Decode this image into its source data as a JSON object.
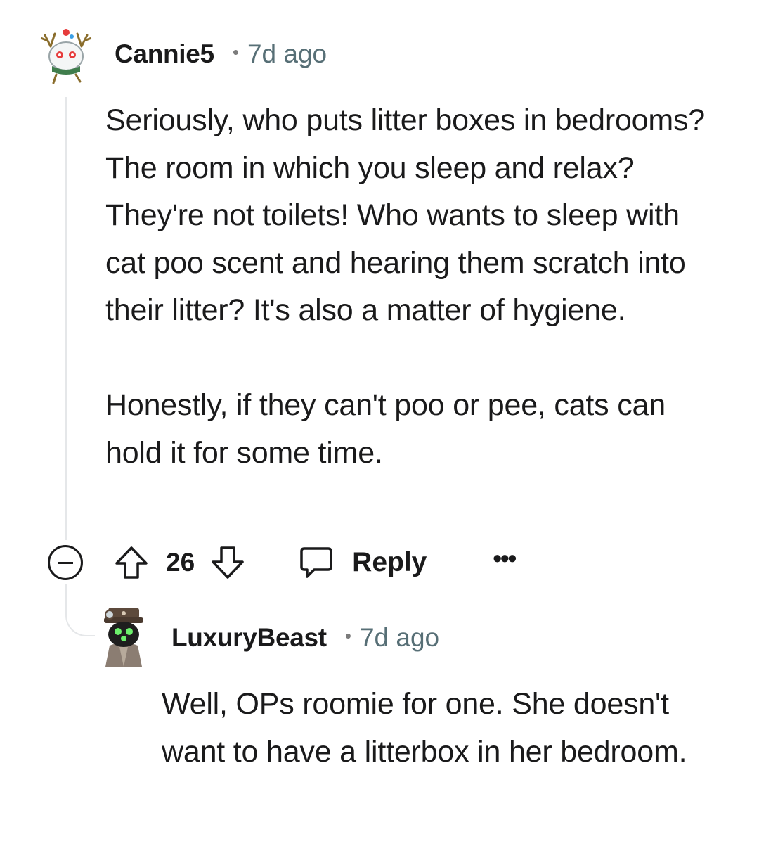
{
  "comments": [
    {
      "username": "Cannie5",
      "separator": "•",
      "time": "7d ago",
      "avatar_icon": "snow-cat-avatar",
      "paragraphs": [
        "Seriously, who puts litter boxes in bedrooms? The room in which you sleep and relax? They're not toilets! Who wants to sleep with cat poo scent and hearing them scratch into their litter? It's also a matter of hygiene.",
        "Honestly, if they can't poo or pee, cats can hold it for some time."
      ],
      "actions": {
        "collapse_icon": "minus-circle-icon",
        "upvote_icon": "arrow-up-icon",
        "vote_count": "26",
        "downvote_icon": "arrow-down-icon",
        "reply_icon": "comment-bubble-icon",
        "reply_label": "Reply",
        "more_label": "•••"
      }
    },
    {
      "username": "LuxuryBeast",
      "separator": "•",
      "time": "7d ago",
      "avatar_icon": "robot-hat-avatar",
      "paragraphs": [
        "Well, OPs roomie for one. She doesn't want to have a litterbox in her bedroom."
      ]
    }
  ],
  "colors": {
    "text": "#1a1a1b",
    "meta": "#576f76",
    "thread_line": "#e5e7e9"
  }
}
